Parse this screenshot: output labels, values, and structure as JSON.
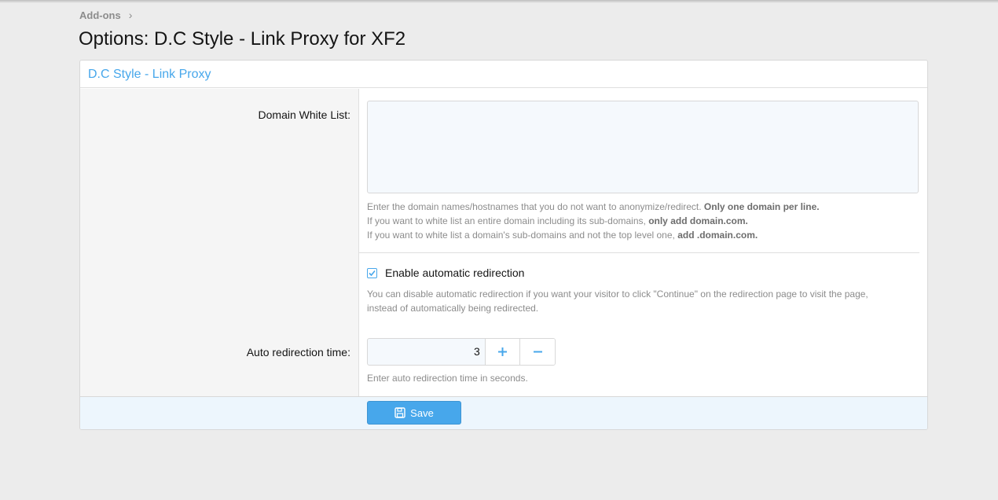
{
  "breadcrumb": {
    "item": "Add-ons",
    "separator": "›"
  },
  "page_title": "Options: D.C Style - Link Proxy for XF2",
  "block": {
    "header": "D.C Style - Link Proxy",
    "domain_white_list": {
      "label": "Domain White List:",
      "value": "",
      "hint_lines": [
        {
          "text": "Enter the domain names/hostnames that you do not want to anonymize/redirect. ",
          "bold": "Only one domain per line."
        },
        {
          "text": "If you want to white list an entire domain including its sub-domains, ",
          "bold": "only add domain.com."
        },
        {
          "text": "If you want to white list a domain's sub-domains and not the top level one, ",
          "bold": "add .domain.com."
        }
      ]
    },
    "auto_redirect": {
      "label": "Enable automatic redirection",
      "checked": true,
      "hint_line1": "You can disable automatic redirection if you want your visitor to click \"Continue\" on the redirection page to visit the page,",
      "hint_line2": "instead of automatically being redirected."
    },
    "auto_redirect_time": {
      "label": "Auto redirection time:",
      "value": "3",
      "hint": "Enter auto redirection time in seconds."
    },
    "save_label": "Save"
  },
  "colors": {
    "accent": "#47a7eb",
    "background": "#ececec"
  }
}
